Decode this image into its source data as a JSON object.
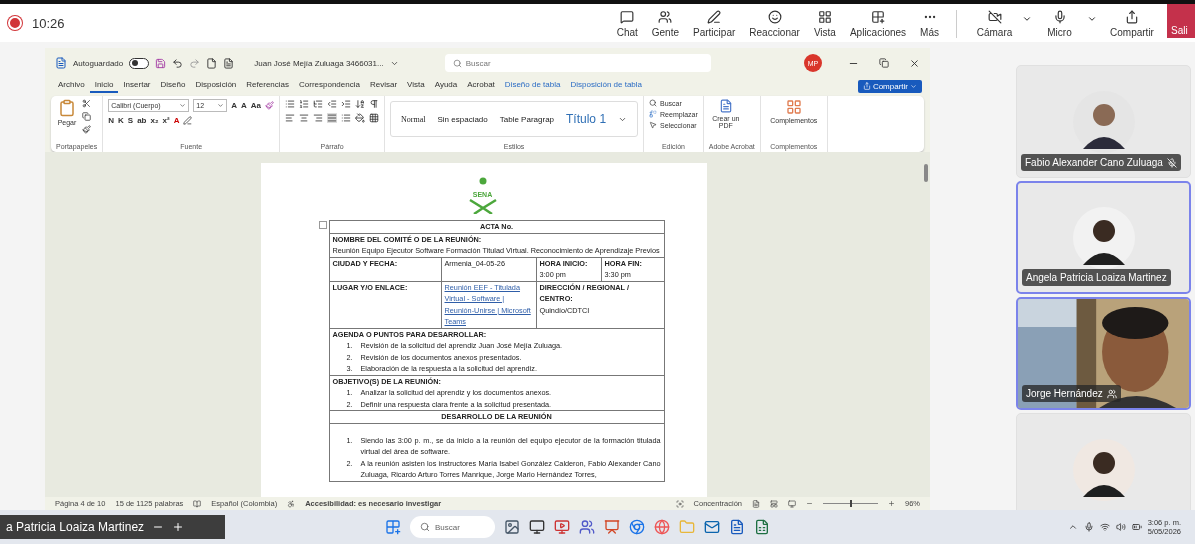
{
  "meeting": {
    "recording": true,
    "time": "10:26",
    "actions": [
      {
        "label": "Chat",
        "kind": "chat"
      },
      {
        "label": "Gente",
        "kind": "people"
      },
      {
        "label": "Participar",
        "kind": "pen"
      },
      {
        "label": "Reaccionar",
        "kind": "smile"
      },
      {
        "label": "Vista",
        "kind": "layout"
      },
      {
        "label": "Aplicaciones",
        "kind": "apps"
      },
      {
        "label": "Más",
        "kind": "more"
      }
    ],
    "devices": [
      {
        "label": "Cámara",
        "kind": "camera"
      },
      {
        "label": "Micro",
        "kind": "mic"
      },
      {
        "label": "Compartir",
        "kind": "share"
      }
    ],
    "leave": "Sali"
  },
  "word": {
    "autosave": {
      "label": "Autoguardado",
      "on": false
    },
    "filename": "Juan José Mejía Zuluaga 3466031...",
    "search_placeholder": "Buscar",
    "user_initials": "MP",
    "share": "Compartir",
    "tabs": [
      {
        "label": "Archivo",
        "selected": false,
        "kind": "normal"
      },
      {
        "label": "Inicio",
        "selected": true,
        "kind": "normal"
      },
      {
        "label": "Insertar",
        "selected": false,
        "kind": "normal"
      },
      {
        "label": "Diseño",
        "selected": false,
        "kind": "normal"
      },
      {
        "label": "Disposición",
        "selected": false,
        "kind": "normal"
      },
      {
        "label": "Referencias",
        "selected": false,
        "kind": "normal"
      },
      {
        "label": "Correspondencia",
        "selected": false,
        "kind": "normal"
      },
      {
        "label": "Revisar",
        "selected": false,
        "kind": "normal"
      },
      {
        "label": "Vista",
        "selected": false,
        "kind": "normal"
      },
      {
        "label": "Ayuda",
        "selected": false,
        "kind": "normal"
      },
      {
        "label": "Acrobat",
        "selected": false,
        "kind": "normal"
      },
      {
        "label": "Diseño de tabla",
        "selected": false,
        "kind": "contextual"
      },
      {
        "label": "Disposición de tabla",
        "selected": false,
        "kind": "contextual"
      }
    ],
    "ribbon": {
      "paste": "Pegar",
      "font_name": "Calibri (Cuerpo)",
      "font_size": "12",
      "font_row1": [
        "A",
        "A",
        "Aa"
      ],
      "font_row2": [
        "N",
        "K",
        "S",
        "ab",
        "x₂",
        "x²",
        "A"
      ],
      "styles": [
        "Normal",
        "Sin espaciado",
        "Table Paragrap",
        "Título 1"
      ],
      "edit": [
        "Buscar",
        "Reemplazar",
        "Seleccionar"
      ],
      "pdf": "Crear un PDF",
      "addins": "Complementos",
      "groups": [
        "Portapapeles",
        "Fuente",
        "Párrafo",
        "Estilos",
        "Edición",
        "Adobe Acrobat",
        "Complementos"
      ]
    },
    "document": {
      "logo": "SENA",
      "title": "ACTA No.",
      "name_label": "NOMBRE DEL COMITÉ O DE LA REUNIÓN:",
      "name_value": "Reunión Equipo Ejecutor Software Formación Titulad Virtual. Reconocimiento de Aprendizaje Previos",
      "city_label": "CIUDAD Y FECHA:",
      "city_value": "Armenia_04-05-26",
      "start_label": "HORA INICIO:",
      "start_value": "3:00 pm",
      "end_label": "HORA FIN:",
      "end_value": "3:30 pm",
      "place_label": "LUGAR Y/O ENLACE:",
      "place_link": "Reunión EEF - Titulada Virtual - Software | Reunión-Unirse | Microsoft Teams",
      "center_label": "DIRECCIÓN / REGIONAL / CENTRO:",
      "center_value": "Quindío/CDTCI",
      "agenda_label": "AGENDA O PUNTOS PARA DESARROLLAR:",
      "agenda": [
        {
          "number": "1.",
          "text": "Revisión de la solicitud del aprendiz Juan José Mejía Zuluaga."
        },
        {
          "number": "2.",
          "text": "Revisión de los documentos anexos presentados."
        },
        {
          "number": "3.",
          "text": "Elaboración de la respuesta a la solicitud del aprendiz."
        }
      ],
      "objectives_label": "OBJETIVO(S) DE LA REUNIÓN:",
      "objectives": [
        {
          "number": "1.",
          "text": "Analizar la solicitud del aprendiz y los documentos anexos."
        },
        {
          "number": "2.",
          "text": "Definir una respuesta clara frente a la solicitud presentada."
        }
      ],
      "development_label": "DESARROLLO DE LA REUNIÓN",
      "development": [
        {
          "number": "1.",
          "text": "Siendo las 3:00 p. m., se da inicio a la reunión del equipo ejecutor de la formación titulada virtual del área de software."
        },
        {
          "number": "2.",
          "text": "A la reunión asisten los instructores María Isabel González Calderon, Fabio Alexander Cano Zuluaga, Ricardo Arturo Torres Manrique, Jorge Mario Hernández Torres,"
        }
      ]
    },
    "status": {
      "page": "Página 4 de 10",
      "words": "15 de 1125 palabras",
      "language": "Español (Colombia)",
      "accessibility": "Accesibilidad: es necesario investigar",
      "focus": "Concentración",
      "zoom": {
        "level": 0.5,
        "label": "96%"
      }
    }
  },
  "participants": [
    {
      "name": "Fabio Alexander Cano Zuluaga",
      "kind": "avatar",
      "speaking": false,
      "muted": true,
      "presenting": false
    },
    {
      "name": "Angela Patricia Loaiza Martinez",
      "kind": "avatar",
      "speaking": true,
      "muted": false,
      "presenting": false
    },
    {
      "name": "Jorge Hernández",
      "kind": "video",
      "speaking": true,
      "muted": false,
      "presenting": true
    },
    {
      "kind": "avatar",
      "speaking": false
    }
  ],
  "taskbar": {
    "floating_name": "a Patricia Loaiza Martinez",
    "search_placeholder": "Buscar",
    "time": "3:06 p. m.",
    "date": "5/05/2026"
  }
}
